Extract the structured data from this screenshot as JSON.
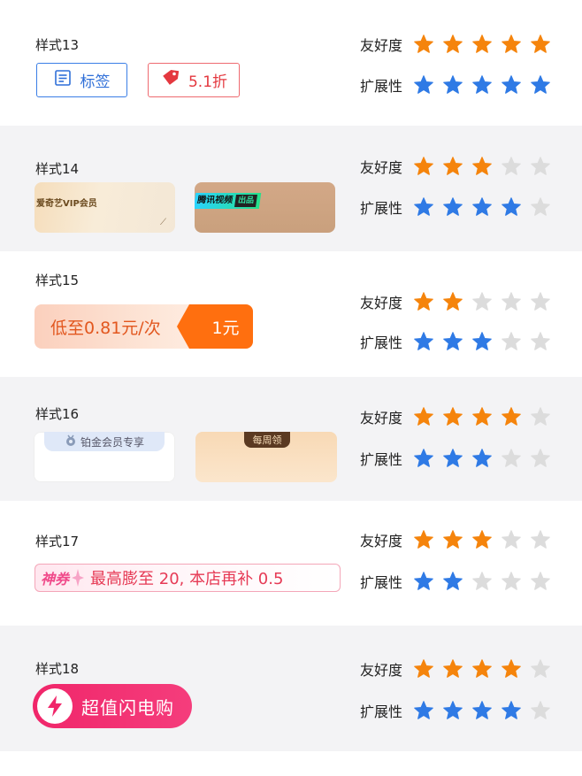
{
  "labels": {
    "friendliness": "友好度",
    "extensibility": "扩展性"
  },
  "colors": {
    "orange_star": "#f5840c",
    "blue_star": "#2f7ae5",
    "empty_star": "#dcdcdc"
  },
  "styles": [
    {
      "title": "样式13",
      "friendliness": 5,
      "extensibility": 5,
      "tag_text": "标签",
      "tag_icon": "document-icon",
      "price_text": "5.1折",
      "price_icon": "price-tag-icon"
    },
    {
      "title": "样式14",
      "friendliness": 3,
      "extensibility": 4,
      "card_a_label": "爱奇艺VIP会员",
      "card_b_label": "腾讯视频",
      "card_b_sub": "出品"
    },
    {
      "title": "样式15",
      "friendliness": 2,
      "extensibility": 3,
      "pill_text": "低至0.81元/次",
      "badge_text": "1元"
    },
    {
      "title": "样式16",
      "friendliness": 4,
      "extensibility": 3,
      "card_a_tab": "铂金会员专享",
      "card_b_tab": "每周领"
    },
    {
      "title": "样式17",
      "friendliness": 3,
      "extensibility": 2,
      "god_text": "神券",
      "bar_text": "最高膨至 20, 本店再补 0.5"
    },
    {
      "title": "样式18",
      "friendliness": 4,
      "extensibility": 4,
      "pill_text": "超值闪电购",
      "pill_icon": "lightning-icon"
    }
  ]
}
